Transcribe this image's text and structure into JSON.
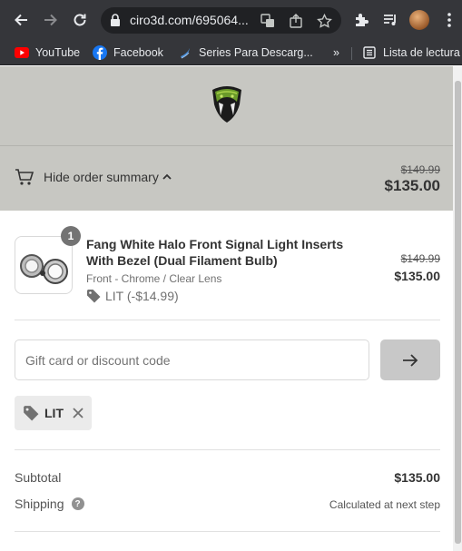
{
  "browser": {
    "url": "ciro3d.com/695064...",
    "bookmarks": [
      {
        "label": "YouTube",
        "icon": "youtube-icon"
      },
      {
        "label": "Facebook",
        "icon": "facebook-icon"
      },
      {
        "label": "Series Para Descarg...",
        "icon": "series-icon"
      }
    ],
    "overflow_label": "»",
    "reading_list": "Lista de lectura"
  },
  "summary": {
    "toggle_label": "Hide order summary",
    "compare_price": "$149.99",
    "total": "$135.00"
  },
  "line_item": {
    "quantity": "1",
    "title": "Fang White Halo Front Signal Light Inserts With Bezel (Dual Filament Bulb)",
    "variant": "Front - Chrome / Clear Lens",
    "discount": "LIT (-$14.99)",
    "compare_price": "$149.99",
    "price": "$135.00"
  },
  "discount_form": {
    "placeholder": "Gift card or discount code"
  },
  "applied_code": {
    "code": "LIT"
  },
  "totals": {
    "subtotal_label": "Subtotal",
    "subtotal_value": "$135.00",
    "shipping_label": "Shipping",
    "shipping_help": "?",
    "shipping_value": "Calculated at next step"
  },
  "colors": {
    "header_band": "#c7c7c2",
    "button_disabled": "#c8c8c8",
    "browser_chrome": "#35363a"
  }
}
